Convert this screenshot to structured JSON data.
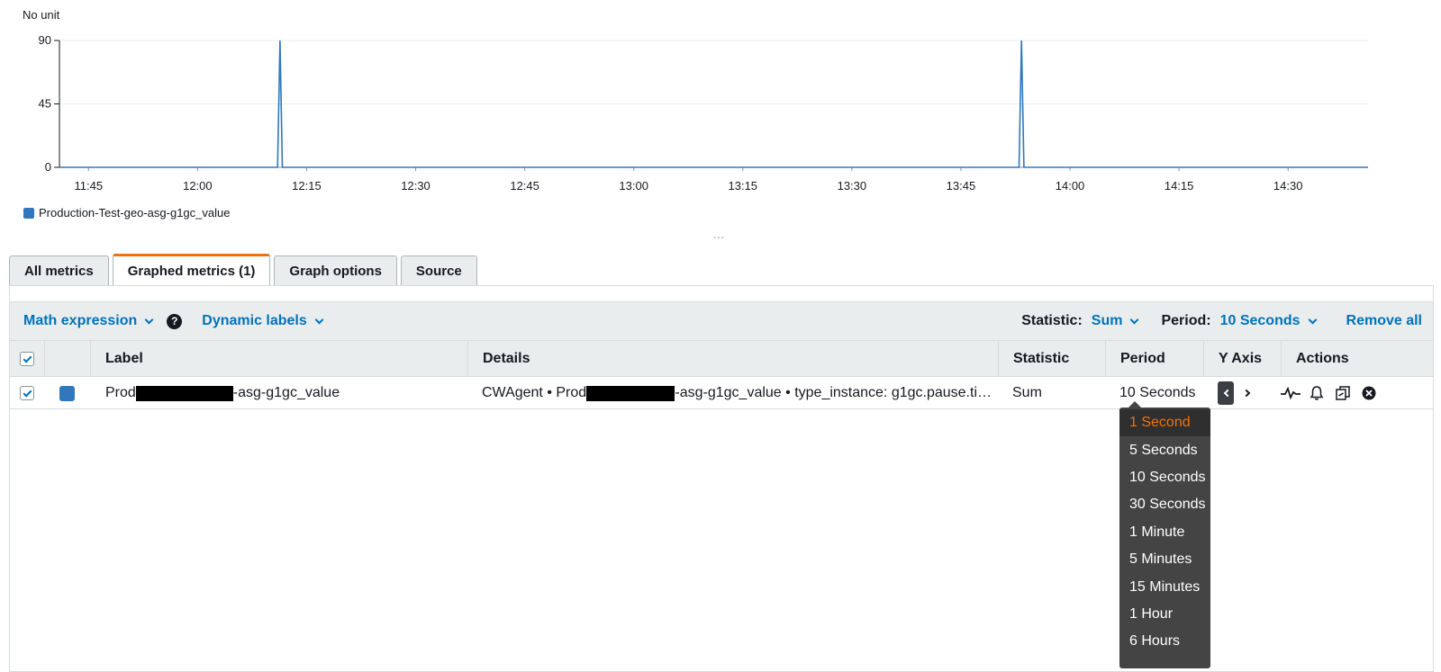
{
  "chart_data": {
    "type": "line",
    "unit_label": "No unit",
    "y_ticks": [
      0,
      45,
      90
    ],
    "ylim": [
      0,
      90
    ],
    "x_ticks": [
      "11:45",
      "12:00",
      "12:15",
      "12:30",
      "12:45",
      "13:00",
      "13:15",
      "13:30",
      "13:45",
      "14:00",
      "14:15",
      "14:30"
    ],
    "xlim": [
      "11:41",
      "14:41"
    ],
    "grid": true,
    "legend_position": "bottom-left",
    "series": [
      {
        "name": "Production-Test-geo-asg-g1gc_value",
        "color": "#2f78bd",
        "points": [
          [
            "11:41",
            0
          ],
          [
            "12:11",
            0
          ],
          [
            "12:11:20",
            90
          ],
          [
            "12:11:40",
            0
          ],
          [
            "13:53",
            0
          ],
          [
            "13:53:20",
            90
          ],
          [
            "13:53:40",
            0
          ],
          [
            "14:41",
            0
          ]
        ]
      }
    ]
  },
  "legend": {
    "label": "Production-Test-geo-asg-g1gc_value",
    "color": "#2f78bd"
  },
  "tabs": [
    {
      "label": "All metrics",
      "active": false
    },
    {
      "label": "Graphed metrics (1)",
      "active": true
    },
    {
      "label": "Graph options",
      "active": false
    },
    {
      "label": "Source",
      "active": false
    }
  ],
  "toolbar": {
    "math_expression": "Math expression",
    "dynamic_labels": "Dynamic labels",
    "statistic_label": "Statistic:",
    "statistic_value": "Sum",
    "period_label": "Period:",
    "period_value": "10 Seconds",
    "remove_all": "Remove all"
  },
  "table": {
    "headers": {
      "label": "Label",
      "details": "Details",
      "statistic": "Statistic",
      "period": "Period",
      "y_axis": "Y Axis",
      "actions": "Actions"
    },
    "row": {
      "label_prefix": "Prod",
      "label_suffix": "-asg-g1gc_value",
      "details_prefix": "CWAgent • Prod",
      "details_suffix": "-asg-g1gc_value • type_instance: g1gc.pause.ti…",
      "statistic": "Sum",
      "period": "10 Seconds",
      "color": "#2f78bd"
    }
  },
  "period_dropdown": {
    "selected": "1 Second",
    "options": [
      "1 Second",
      "5 Seconds",
      "10 Seconds",
      "30 Seconds",
      "1 Minute",
      "5 Minutes",
      "15 Minutes",
      "1 Hour",
      "6 Hours"
    ]
  },
  "colors": {
    "accent": "#ec7211",
    "link": "#0073bb",
    "series": "#2f78bd",
    "dropdown_bg": "#444444"
  }
}
